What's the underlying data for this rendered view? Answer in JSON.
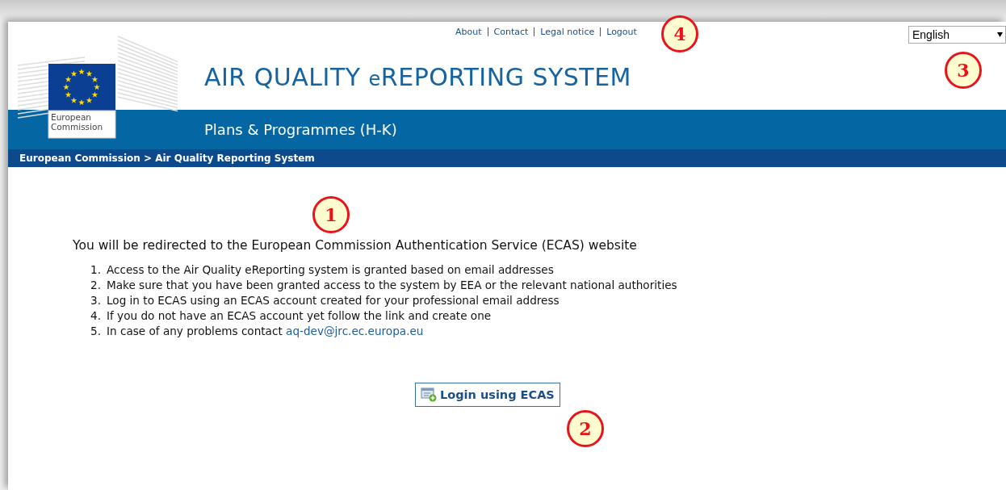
{
  "top_links": [
    "About",
    "Contact",
    "Legal notice",
    "Logout"
  ],
  "language_select": {
    "value": "English"
  },
  "logo": {
    "caption": [
      "European",
      "Commission"
    ]
  },
  "header": {
    "title_parts": [
      "AIR QUALITY ",
      "e",
      "REPORTING SYSTEM"
    ],
    "subtitle": "Plans & Programmes (H-K)"
  },
  "breadcrumb": "European Commission > Air Quality Reporting System",
  "intro": "You will be redirected to the European Commission Authentication Service (ECAS) website",
  "steps": [
    {
      "number": "1.",
      "text": "Access to the Air Quality eReporting system is granted based on email addresses"
    },
    {
      "number": "2.",
      "text": "Make sure that you have been granted access to the system by EEA or the relevant national authorities"
    },
    {
      "number": "3.",
      "text": "Log in to ECAS using an ECAS account created for your professional email address"
    },
    {
      "number": "4.",
      "text": "If you do not have an ECAS account yet follow the link and create one"
    },
    {
      "number": "5.",
      "text": "In case of any problems contact ",
      "link": "aq-dev@jrc.ec.europa.eu"
    }
  ],
  "login_button": "Login using ECAS",
  "callouts": [
    "4",
    "3",
    "1",
    "2"
  ]
}
